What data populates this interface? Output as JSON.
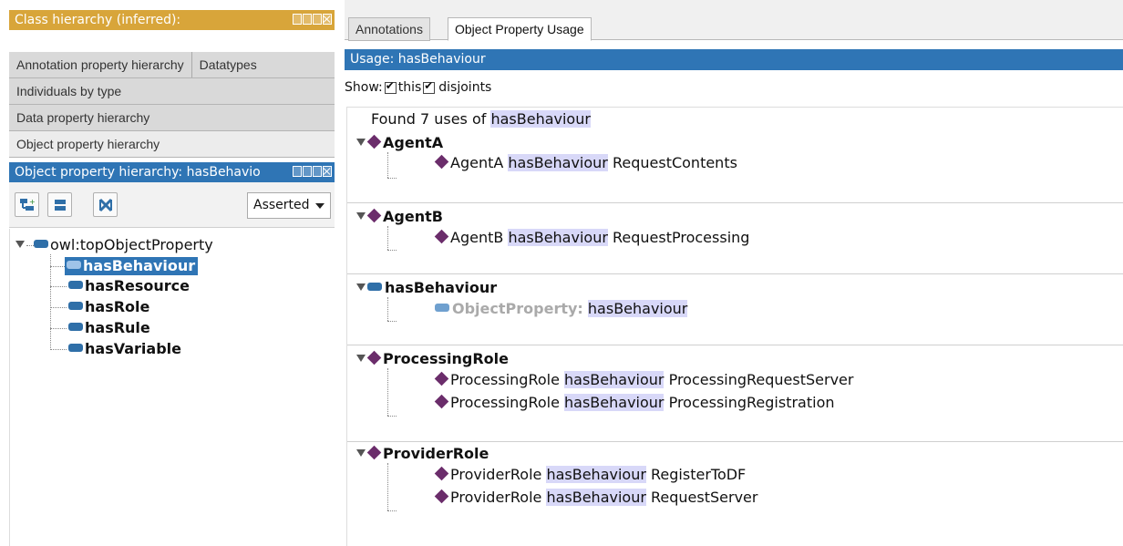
{
  "left": {
    "class_header": "Class hierarchy (inferred):",
    "tabs_row1": [
      "Annotation property hierarchy",
      "Datatypes"
    ],
    "tab_individuals": "Individuals by type",
    "tab_data_property": "Data property hierarchy",
    "tab_object_property": "Object property hierarchy",
    "obj_header": "Object property hierarchy: hasBehavio",
    "dropdown_value": "Asserted",
    "tree": {
      "root": "owl:topObjectProperty",
      "children": [
        "hasBehaviour",
        "hasResource",
        "hasRole",
        "hasRule",
        "hasVariable"
      ]
    }
  },
  "right": {
    "tabs": [
      "Annotations",
      "Object Property Usage"
    ],
    "usage_title": "Usage: hasBehaviour",
    "show_label": "Show:",
    "show_options": [
      "this",
      "disjoints"
    ],
    "found_prefix": "Found 7 uses of",
    "found_term": "hasBehaviour",
    "groups": [
      {
        "head": "AgentA",
        "icon": "diamond",
        "items": [
          [
            "AgentA",
            "hasBehaviour",
            "RequestContents"
          ]
        ]
      },
      {
        "head": "AgentB",
        "icon": "diamond",
        "items": [
          [
            "AgentB",
            "hasBehaviour",
            "RequestProcessing"
          ]
        ]
      },
      {
        "head": "hasBehaviour",
        "icon": "pill",
        "items": [
          [
            "ObjectProperty:",
            "hasBehaviour",
            ""
          ]
        ]
      },
      {
        "head": "ProcessingRole",
        "icon": "diamond",
        "items": [
          [
            "ProcessingRole",
            "hasBehaviour",
            "ProcessingRequestServer"
          ],
          [
            "ProcessingRole",
            "hasBehaviour",
            "ProcessingRegistration"
          ]
        ]
      },
      {
        "head": "ProviderRole",
        "icon": "diamond",
        "items": [
          [
            "ProviderRole",
            "hasBehaviour",
            "RegisterToDF"
          ],
          [
            "ProviderRole",
            "hasBehaviour",
            "RequestServer"
          ]
        ]
      }
    ]
  },
  "colors": {
    "class_header": "#d8a53a",
    "selection_blue": "#2f75b5",
    "individual_diamond": "#6b2d6b",
    "property_pill": "#2f6fa8",
    "highlight": "#d8d8f8"
  }
}
